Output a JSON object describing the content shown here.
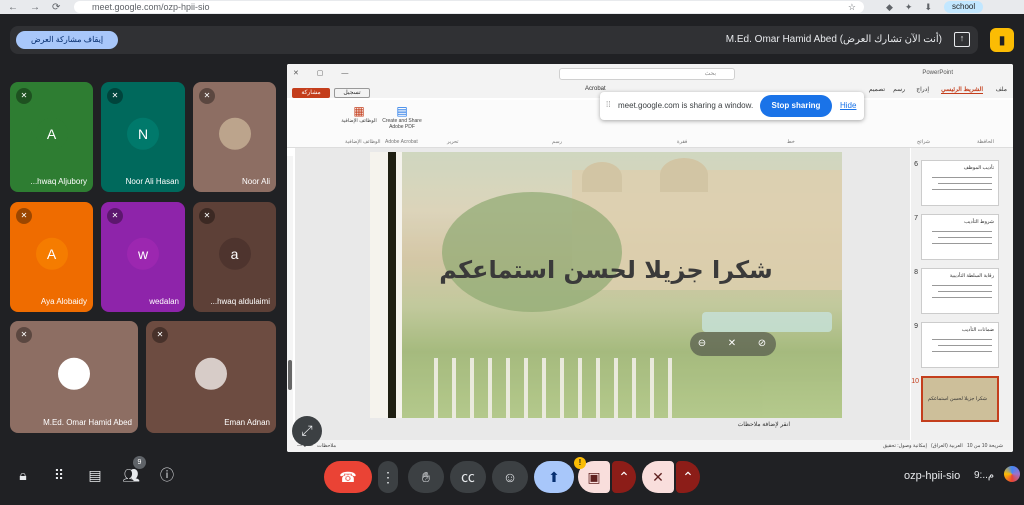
{
  "browser": {
    "url": "meet.google.com/ozp-hpii-sio",
    "profile_label": "school"
  },
  "banner": {
    "stop_presenting": "إيقاف مشاركة العرض",
    "presenting_text": "M.Ed. Omar Hamid Abed (أنت الآن تشارك العرض)"
  },
  "participants": [
    {
      "name": "...hwaq Aljubory",
      "initial": "A",
      "bg": "#2e7d32",
      "avatar_bg": "#2e7d32",
      "muted": true
    },
    {
      "name": "Noor Ali Hasan",
      "initial": "N",
      "bg": "#00695c",
      "avatar_bg": "#00796b",
      "muted": true
    },
    {
      "name": "Noor Ali",
      "initial": "",
      "bg": "#8d6e63",
      "avatar_bg": "#bca48c",
      "muted": true
    },
    {
      "name": "Aya Alobaidy",
      "initial": "A",
      "bg": "#ef6c00",
      "avatar_bg": "#f57c00",
      "muted": true
    },
    {
      "name": "wedalan",
      "initial": "w",
      "bg": "#8e24aa",
      "avatar_bg": "#9c27b0",
      "muted": true
    },
    {
      "name": "...hwaq aldulaimi",
      "initial": "a",
      "bg": "#5d4037",
      "avatar_bg": "#4e342e",
      "muted": true
    },
    {
      "name": "M.Ed. Omar Hamid Abed",
      "initial": "",
      "bg": "#8d6e63",
      "avatar_bg": "#ffffff",
      "muted": true
    },
    {
      "name": "Eman Adnan",
      "initial": "",
      "bg": "#6d4c41",
      "avatar_bg": "#d7ccc8",
      "muted": true
    }
  ],
  "share_popup": {
    "message": "meet.google.com is sharing a window.",
    "stop_label": "Stop sharing",
    "hide_label": "Hide"
  },
  "powerpoint": {
    "search_placeholder": "بحث",
    "title": "PowerPoint",
    "tabs": [
      "ملف",
      "الشريط الرئيسي",
      "إدراج",
      "رسم",
      "تصميم",
      "Acrobat"
    ],
    "share_button": "مشاركة",
    "record_button": "تسجيل",
    "ribbon_groups": [
      "الحافظة",
      "شرائح",
      "خط",
      "فقرة",
      "رسم",
      "تحرير",
      "Adobe Acrobat",
      "الوظائف الإضافية"
    ],
    "acrobat_button": "Create and Share Adobe PDF",
    "addins_button": "الوظائف الإضافية",
    "slide_title": "شكرا جزيلا لحسن استماعكم",
    "notes_hint": "انقر لإضافة ملاحظات",
    "thumbnails": [
      {
        "number": "6",
        "title": "تأديب الموظف"
      },
      {
        "number": "7",
        "title": "شروط التأديب"
      },
      {
        "number": "8",
        "title": "رقابة السلطة التأديبية"
      },
      {
        "number": "9",
        "title": "ضمانات التأديب"
      },
      {
        "number": "10",
        "title": "شكرا جزيلا لحسن استماعكم"
      }
    ],
    "status_left": "شريحة 10 من 10",
    "status_language": "العربية (العراق)",
    "status_accessibility": "إمكانية وصول: تحقيق",
    "status_notes": "ملاحظات"
  },
  "toolbar": {
    "chat_badge": "9",
    "meeting_code": "ozp-hpii-sio",
    "time": "9:..م"
  },
  "colors": {
    "accent": "#1a73e8",
    "end_call": "#ea4335",
    "powerpoint": "#c43e1c",
    "present_active": "#a8c7fa"
  }
}
